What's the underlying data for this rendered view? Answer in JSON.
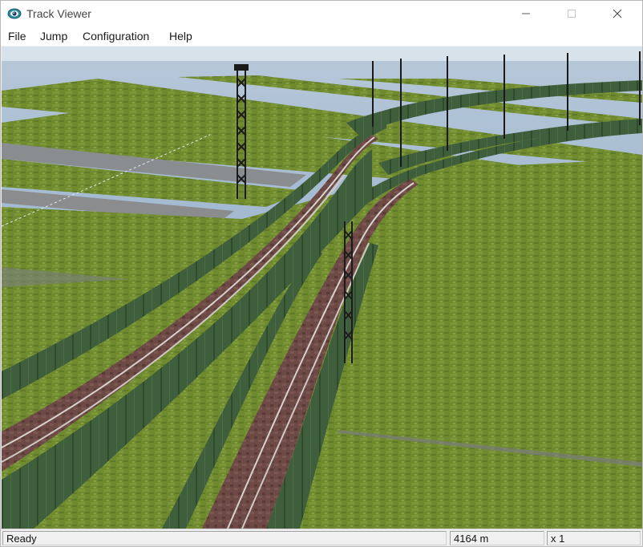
{
  "window": {
    "title": "Track Viewer",
    "icon": "eye-icon"
  },
  "menu": [
    "File",
    "Jump",
    "Configuration",
    "Help"
  ],
  "status": {
    "message": "Ready",
    "distance": "4164 m",
    "speed_multiplier": "x 1"
  },
  "colors": {
    "grass": "#6e8a2e",
    "sky": "#a9c0d6",
    "viaduct_wall": "#3c5c3a",
    "track_bed": "#6b4a44"
  }
}
